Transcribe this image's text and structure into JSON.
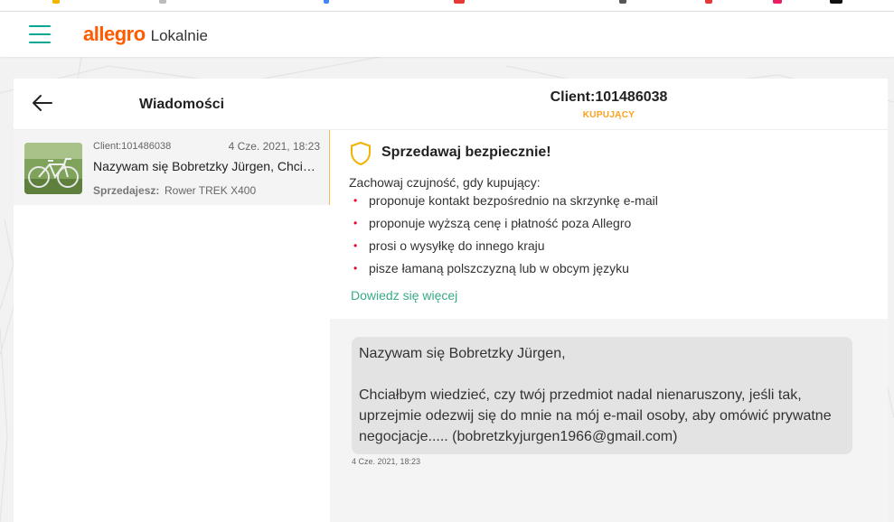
{
  "app": {
    "logo_brand": "allegro",
    "logo_sub": "Lokalnie"
  },
  "colors": {
    "brand": "#ff5a00",
    "accent": "#00a790",
    "warning": "#ff9f1a",
    "link": "#3aa98a",
    "bullet": "#e4002b"
  },
  "header": {
    "menu_icon": "hamburger-icon"
  },
  "sidebar": {
    "back_icon": "arrow-left-icon",
    "title": "Wiadomości",
    "conversations": [
      {
        "client": "Client:101486038",
        "date": "4 Cze. 2021, 18:23",
        "preview": "Nazywam się Bobretzky Jürgen, Chciałbym wiedzieć, czy twój przedmiot nadal nienaruszony",
        "sold_label": "Sprzedajesz:",
        "product": "Rower TREK X400"
      }
    ]
  },
  "chat": {
    "client_name": "Client:101486038",
    "client_role": "KUPUJĄCY",
    "safety": {
      "icon": "shield-icon",
      "title": "Sprzedawaj bezpiecznie!",
      "intro": "Zachowaj czujność, gdy kupujący:",
      "items": [
        "proponuje kontakt bezpośrednio na skrzynkę e-mail",
        "proponuje wyższą cenę i płatność poza Allegro",
        "prosi o wysyłkę do innego kraju",
        "pisze łamaną polszczyzną lub w obcym języku"
      ],
      "link": "Dowiedz się więcej"
    },
    "message": {
      "lines": [
        "Nazywam się Bobretzky Jürgen,",
        "Chciałbym wiedzieć, czy twój przedmiot nadal nienaruszony, jeśli tak,",
        "uprzejmie odezwij się do mnie na mój e-mail osoby, aby omówić prywatne",
        "negocjacje..... (bobretzkyjurgen1966@gmail.com)"
      ],
      "time": "4 Cze. 2021, 18:23"
    }
  }
}
